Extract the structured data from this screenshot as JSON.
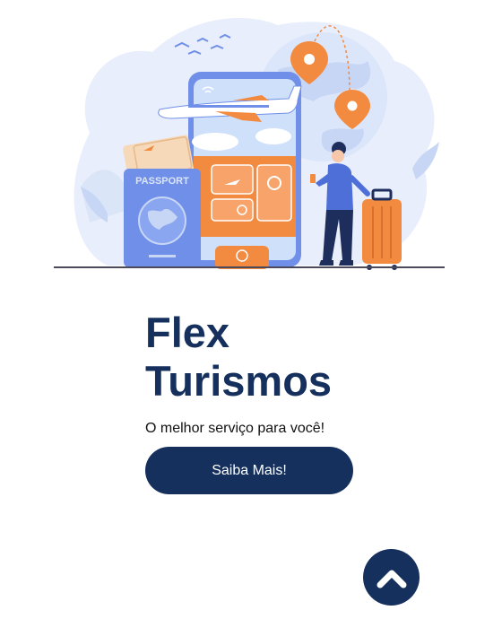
{
  "hero": {
    "illustration_icon": "travel-booking-illustration",
    "passport_label": "PASSPORT"
  },
  "brand": {
    "title_line1": "Flex",
    "title_line2": "Turismos",
    "tagline": "O melhor serviço para você!"
  },
  "cta": {
    "label": "Saiba Mais!"
  },
  "scroll_top": {
    "icon": "chevron-up-icon"
  },
  "colors": {
    "primary_navy": "#16305e",
    "accent_orange": "#f28a40",
    "illustration_blue": "#6f8fe8",
    "background_blob": "#e8eefb"
  }
}
